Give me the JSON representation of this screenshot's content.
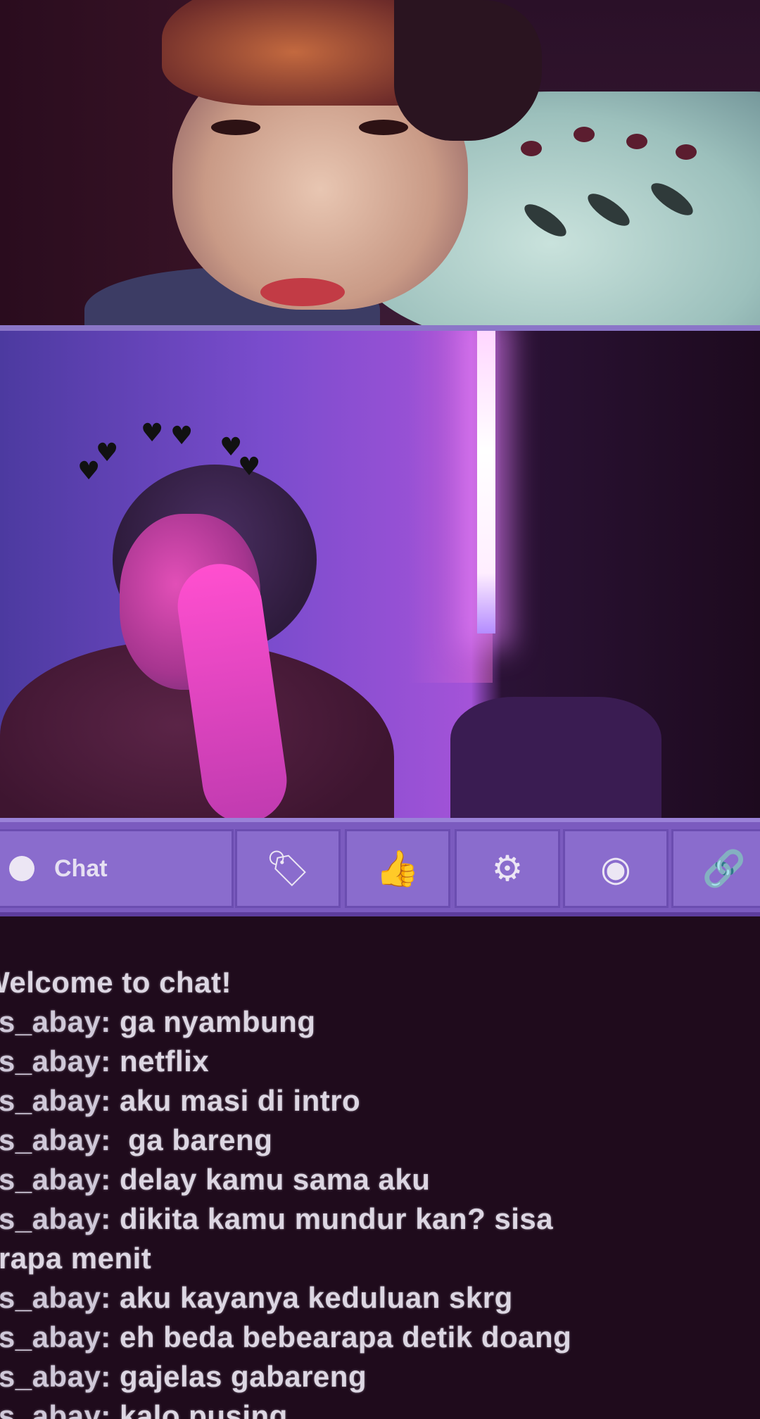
{
  "toolbar": {
    "chat_label": "Chat",
    "buttons": [
      {
        "name": "tag-icon",
        "glyph": "🏷"
      },
      {
        "name": "thumb-icon",
        "glyph": "👍"
      },
      {
        "name": "gear-icon",
        "glyph": "⚙"
      },
      {
        "name": "circle-icon",
        "glyph": "◉"
      },
      {
        "name": "link-icon",
        "glyph": "🔗"
      }
    ]
  },
  "overlay": {
    "hearts_glyph": "♥"
  },
  "chat": {
    "welcome": "Welcome to chat!",
    "messages": [
      {
        "user": "as_abay:",
        "text": " ga nyambung"
      },
      {
        "user": "as_abay:",
        "text": " netflix"
      },
      {
        "user": "as_abay:",
        "text": " aku masi di intro"
      },
      {
        "user": "as_abay:",
        "text": "  ga bareng"
      },
      {
        "user": "as_abay:",
        "text": " delay kamu sama aku"
      },
      {
        "user": "as_abay:",
        "text": " dikita kamu mundur kan? sisa"
      },
      {
        "user": "",
        "text": "erapa menit"
      },
      {
        "user": "as_abay:",
        "text": " aku kayanya keduluan skrg"
      },
      {
        "user": "as_abay:",
        "text": " eh beda bebearapa detik doang"
      },
      {
        "user": "as_abay:",
        "text": " gajelas gabareng"
      },
      {
        "user": "as_abay:",
        "text": " kalo pusing"
      }
    ]
  },
  "colors": {
    "toolbar": "#7b5bbf",
    "chat_bg": "#1f0b1c",
    "chat_text": "#dcd6e2"
  }
}
